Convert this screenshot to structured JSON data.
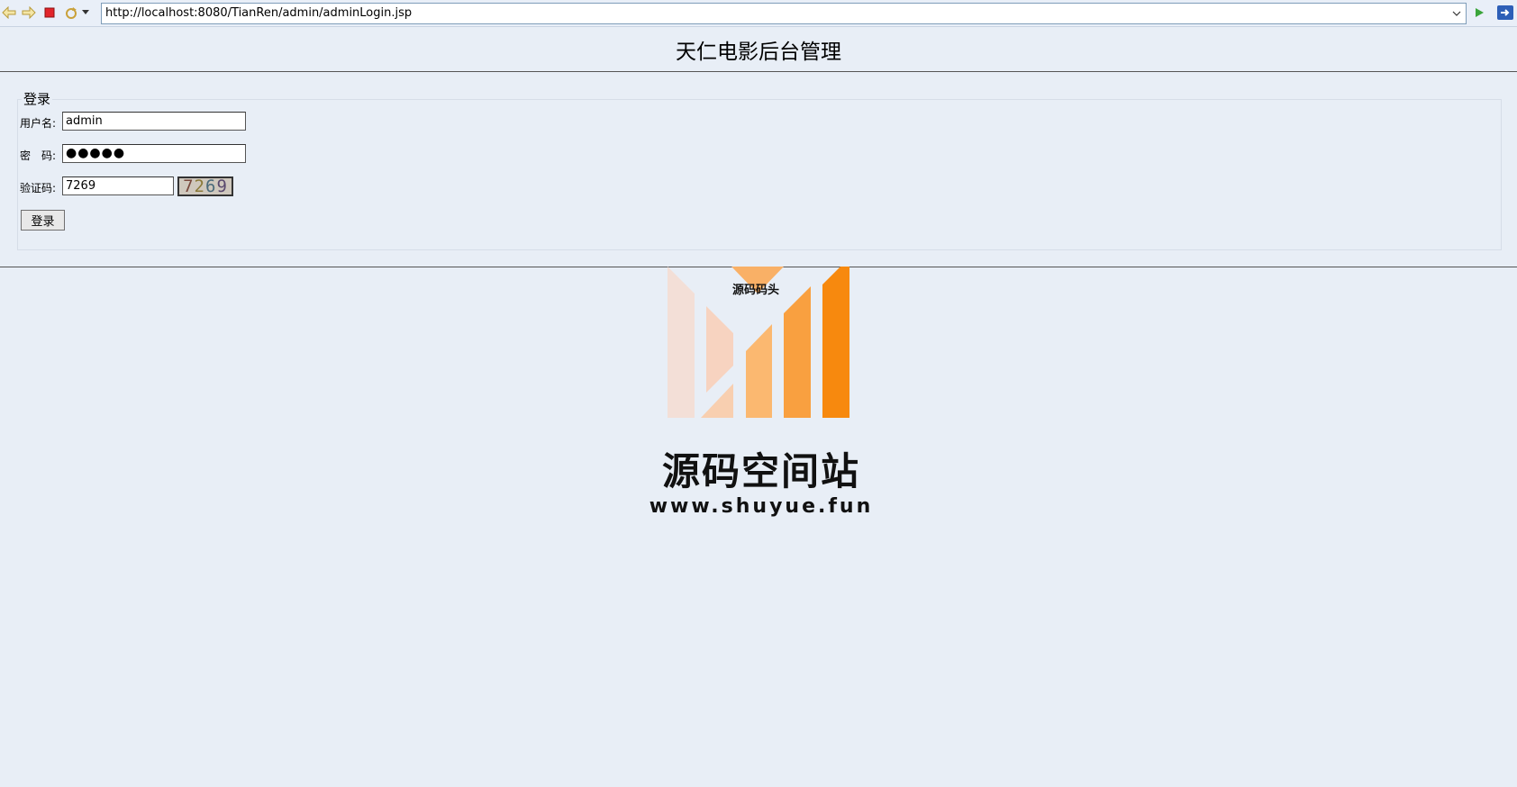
{
  "browser": {
    "url": "http://localhost:8080/TianRen/admin/adminLogin.jsp"
  },
  "header": {
    "title": "天仁电影后台管理"
  },
  "login": {
    "legend": "登录",
    "username_label": "用户名:",
    "username_value": "admin",
    "password_label": "密　码:",
    "password_value": "●●●●●",
    "captcha_label": "验证码:",
    "captcha_value": "7269",
    "captcha_digits": [
      "7",
      "2",
      "6",
      "9"
    ],
    "submit_label": "登录"
  },
  "watermark": {
    "small_text": "源码码头",
    "title": "源码空间站",
    "url": "www.shuyue.fun"
  },
  "colors": {
    "page_bg": "#e8eef6",
    "accent_orange": "#f7890e"
  }
}
